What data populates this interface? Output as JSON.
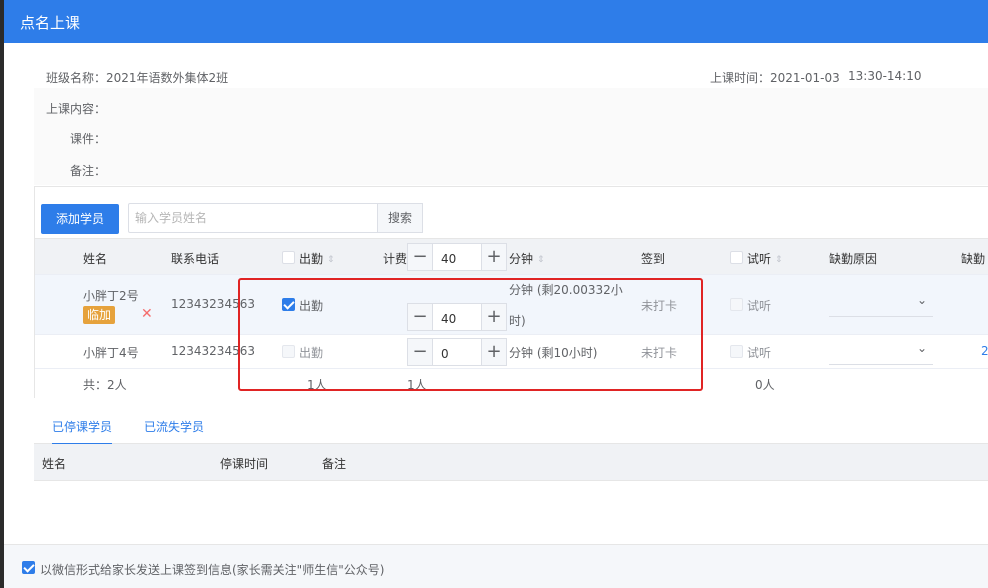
{
  "dialog": {
    "title": "点名上课"
  },
  "class_info": {
    "class_name": "班级名称：2021年语数外集体2班",
    "class_time_label": "上课时间：2021-01-03",
    "class_time_value": "13:30-14:10",
    "content_label": "上课内容：",
    "courseware_label": "课件：",
    "remark_label": "备注："
  },
  "toolbar": {
    "add_student_label": "添加学员",
    "search_placeholder": "输入学员姓名",
    "search_button_label": "搜索"
  },
  "table": {
    "headers": {
      "name": "姓名",
      "phone": "联系电话",
      "attend": "出勤",
      "fee": "计费",
      "fee_value": "40",
      "minute": "分钟",
      "signin": "签到",
      "trial": "试听",
      "absence_reason": "缺勤原因",
      "absence_extra": "缺勤"
    },
    "rows": [
      {
        "name": "小胖丁2号",
        "tag": "临加",
        "phone": "12343234563",
        "attend_label": "出勤",
        "attend_checked": true,
        "fee_value": "40",
        "minute_text_line1": "分钟 (剩20.00332小",
        "minute_text_line2": "时)",
        "signin": "未打卡",
        "trial_label": "试听"
      },
      {
        "name": "小胖丁4号",
        "phone": "12343234563",
        "attend_label": "出勤",
        "attend_checked": false,
        "fee_value": "0",
        "minute_text": "分钟 (剩10小时)",
        "signin": "未打卡",
        "trial_label": "试听",
        "extra": "2"
      }
    ],
    "footer": {
      "total": "共：2人",
      "attend_count": "1人",
      "fee_count": "1人",
      "trial_count": "0人"
    }
  },
  "tabs": {
    "stopped": "已停课学员",
    "lost": "已流失学员"
  },
  "stopped_table": {
    "name": "姓名",
    "stop_time": "停课时间",
    "remark": "备注"
  },
  "footer": {
    "wechat_notice": "以微信形式给家长发送上课签到信息(家长需关注\"师生信\"公众号)"
  },
  "colors": {
    "primary": "#2e7de9",
    "tag": "#e6a23c",
    "delete": "#f56c6c",
    "highlight_box": "#e02424"
  }
}
